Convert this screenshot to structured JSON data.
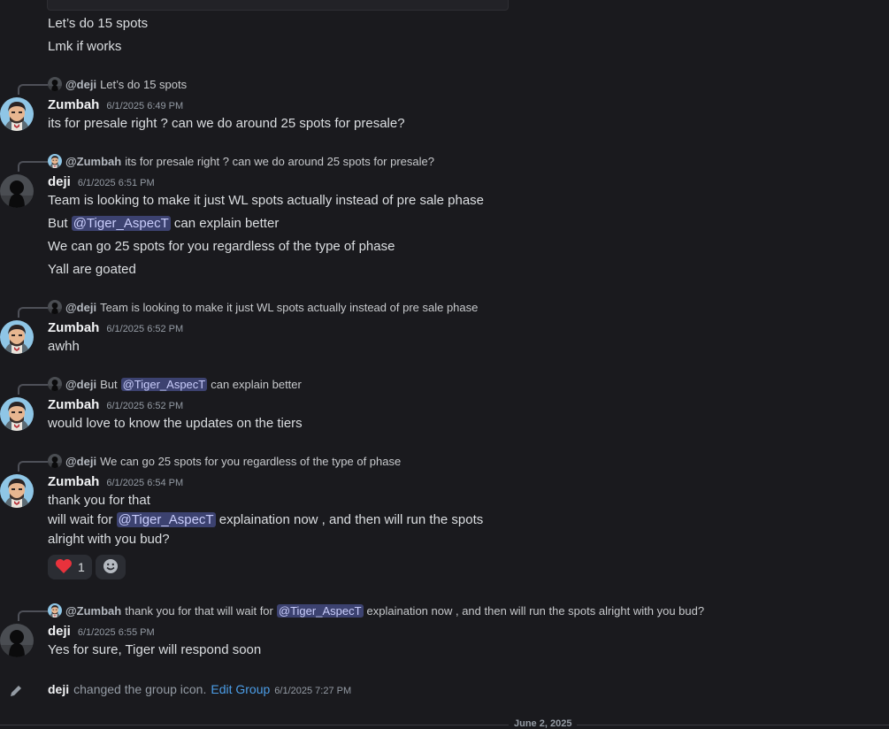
{
  "m0": {
    "l1": "Let’s do 15 spots",
    "l2": "Lmk if works"
  },
  "m1": {
    "reply": {
      "name": "@deji",
      "text": "Let’s do 15 spots"
    },
    "user": "Zumbah",
    "time": "6/1/2025 6:49 PM",
    "l1": "its for presale right ? can we do around 25 spots for presale?"
  },
  "m2": {
    "reply": {
      "name": "@Zumbah",
      "text": "its for presale right ? can we do around 25 spots for presale?"
    },
    "user": "deji",
    "time": "6/1/2025 6:51 PM",
    "l1": "Team is looking to make it just WL spots actually instead of pre sale phase",
    "l2_pre": "But",
    "l2_mention": "@Tiger_AspecT",
    "l2_post": "can explain better",
    "l3": "We can go 25 spots for you regardless of the type of phase",
    "l4": "Yall are goated"
  },
  "m3": {
    "reply": {
      "name": "@deji",
      "text": "Team is looking to make it just WL spots actually instead of pre sale phase"
    },
    "user": "Zumbah",
    "time": "6/1/2025 6:52 PM",
    "l1": "awhh"
  },
  "m4": {
    "reply": {
      "name": "@deji",
      "pre": "But",
      "mention": "@Tiger_AspecT",
      "post": "can explain better"
    },
    "user": "Zumbah",
    "time": "6/1/2025 6:52 PM",
    "l1": "would love to know the updates on the tiers"
  },
  "m5": {
    "reply": {
      "name": "@deji",
      "text": "We can go 25 spots for you regardless of the type of phase"
    },
    "user": "Zumbah",
    "time": "6/1/2025 6:54 PM",
    "l1": "thank you for that",
    "l2_pre": "will wait for",
    "l2_mention": "@Tiger_AspecT",
    "l2_post": "explaination now , and then will run the spots",
    "l3": "alright with you bud?",
    "reaction": {
      "emoji": "heart",
      "count": "1"
    },
    "add_reaction_icon": "smile-icon"
  },
  "m6": {
    "reply": {
      "name": "@Zumbah",
      "pre": "thank you for that will wait for",
      "mention": "@Tiger_AspecT",
      "post": "explaination now , and then will run the spots alright with you bud?"
    },
    "user": "deji",
    "time": "6/1/2025 6:55 PM",
    "l1": "Yes for sure, Tiger will respond soon"
  },
  "system": {
    "icon": "pencil-icon",
    "user": "deji",
    "text": "changed the group icon.",
    "link": "Edit Group",
    "time": "6/1/2025 7:27 PM"
  },
  "divider": {
    "label": "June 2, 2025"
  },
  "colors": {
    "background": "#1a1a1e",
    "mention_bg": "#3c4270",
    "link": "#4c9ee8",
    "heart": "#e8323c"
  }
}
